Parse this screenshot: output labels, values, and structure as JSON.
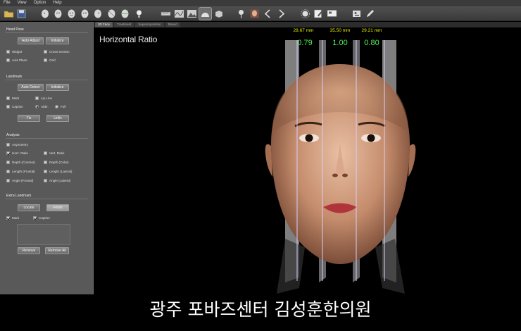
{
  "menu": [
    "File",
    "View",
    "Option",
    "Help"
  ],
  "toolbar_icons": [
    "open-folder-icon",
    "save-icon",
    "face-profile-icon",
    "face-left-icon",
    "face-front-icon",
    "face-right-icon",
    "face-icon",
    "face-alt-icon",
    "face-scan-icon",
    "lamp-icon",
    "ruler-icon",
    "curve-icon",
    "mountain-icon",
    "half-face-icon",
    "cube-icon",
    "pin-icon",
    "portrait-icon",
    "arrow-left-icon",
    "arrow-right-icon",
    "sun-icon",
    "edit-icon",
    "monitor-icon",
    "settings-icon",
    "pen-icon"
  ],
  "tabs": [
    "3D Face",
    "Treatment",
    "Superimposition",
    "Report"
  ],
  "panel": {
    "head_pose": {
      "title": "Head Pose",
      "auto_adjust": "Auto Adjust",
      "initialize": "Initialize",
      "widget": "Widget",
      "cross_section": "Cross Section",
      "axis_plane": "Axis Plane",
      "grid": "Grid"
    },
    "landmark": {
      "title": "Landmark",
      "auto_detect": "Auto Detect",
      "initialize": "Initialize",
      "mark": "Mark",
      "lip_line": "Lip Line",
      "caption": "Caption",
      "abbr": "Abbr.",
      "full": "Full",
      "fix": "Fix",
      "unfix": "Unfix"
    },
    "analysis": {
      "title": "Analysis",
      "items": [
        "Asymmetry",
        "Horz. Ratio",
        "Vert. Ratio",
        "Depth (Contour)",
        "Depth (Color)",
        "Length (Frontal)",
        "Length (Lateral)",
        "Angle (Frontal)",
        "Angle (Lateral)"
      ]
    },
    "extra_landmark": {
      "title": "Extra Landmark",
      "locate": "Locate",
      "finish": "Finish",
      "mark": "Mark",
      "caption": "Caption",
      "remove": "Remove",
      "remove_all": "Remove All"
    }
  },
  "viewport": {
    "title": "Horizontal Ratio",
    "measurements_mm": [
      "28.67 mm",
      "35.50 mm",
      "29.21 mm"
    ],
    "ratios": [
      "0.79",
      "1.00",
      "0.80"
    ],
    "colors": {
      "mm": "#e6f000",
      "ratio": "#52f05a"
    }
  },
  "caption": "광주 포바즈센터 김성훈한의원"
}
